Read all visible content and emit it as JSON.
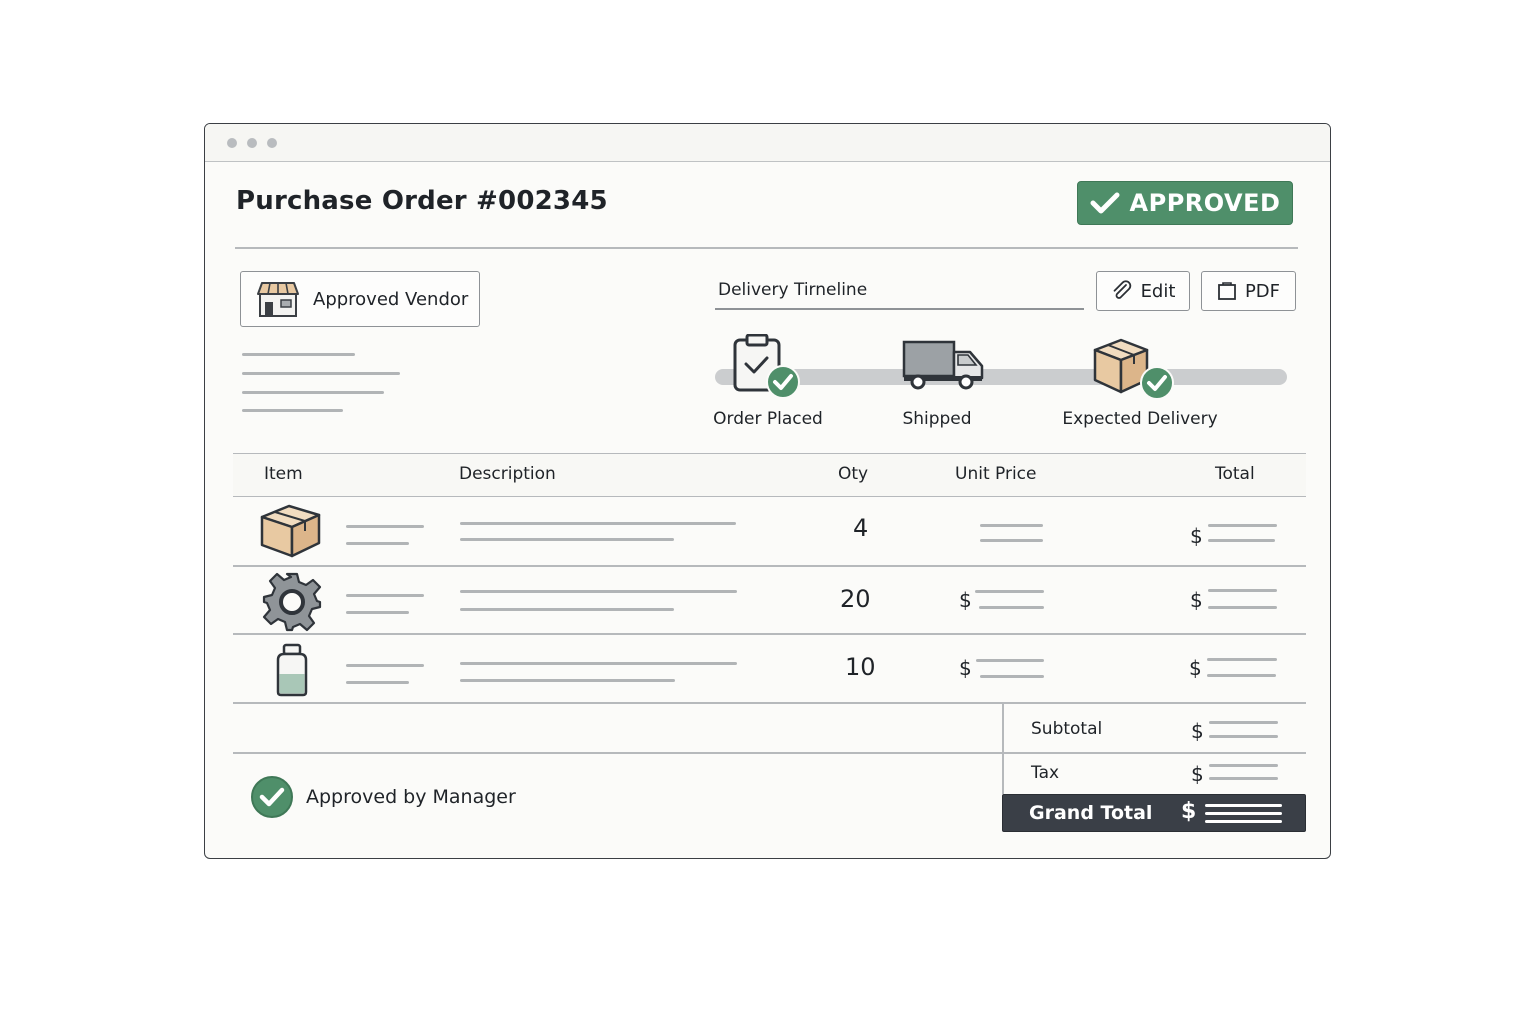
{
  "order": {
    "title": "Purchase Order #002345",
    "status_label": "APPROVED"
  },
  "vendor": {
    "label": "Approved Vendor"
  },
  "timeline": {
    "label": "Delivery Tirneline",
    "steps": [
      {
        "label": "Order Placed",
        "icon": "clipboard-check-icon"
      },
      {
        "label": "Shipped",
        "icon": "truck-icon"
      },
      {
        "label": "Expected Delivery",
        "icon": "package-check-icon"
      }
    ]
  },
  "actions": {
    "edit_label": "Edit",
    "pdf_label": "PDF"
  },
  "table": {
    "headers": {
      "item": "Item",
      "description": "Description",
      "qty": "Oty",
      "unit_price": "Unit Price",
      "total": "Total"
    },
    "rows": [
      {
        "icon": "box-icon",
        "qty": "4",
        "unit_currency": "",
        "total_currency": "$"
      },
      {
        "icon": "gear-icon",
        "qty": "20",
        "unit_currency": "$",
        "total_currency": "$"
      },
      {
        "icon": "bottle-icon",
        "qty": "10",
        "unit_currency": "$",
        "total_currency": "$"
      }
    ]
  },
  "summary": {
    "subtotal_label": "Subtotal",
    "subtotal_currency": "$",
    "tax_label": "Tax",
    "tax_currency": "$",
    "grand_total_label": "Grand Total",
    "grand_total_currency": "$"
  },
  "approval": {
    "label": "Approved by Manager"
  },
  "colors": {
    "accent_green": "#4f8f6a",
    "dark": "#3a3f47",
    "box": "#e8c9a2"
  }
}
